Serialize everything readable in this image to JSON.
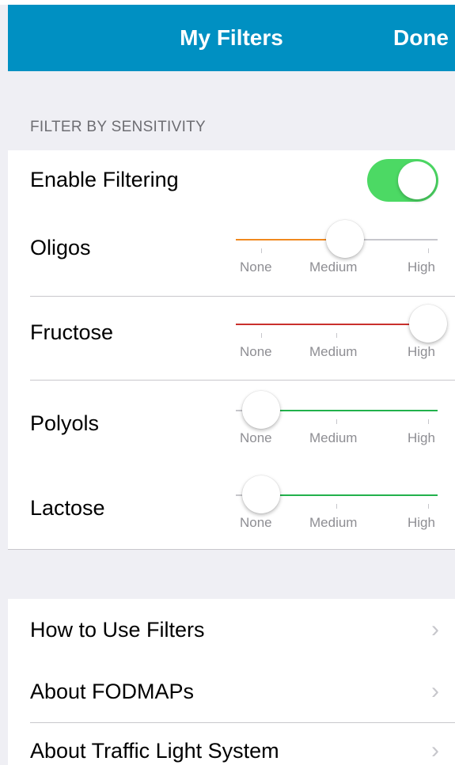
{
  "nav": {
    "title": "My Filters",
    "done_label": "Done"
  },
  "section_header": "FILTER BY SENSITIVITY",
  "enable_filtering": {
    "label": "Enable Filtering",
    "on": true,
    "color": "#4cd964"
  },
  "tick_labels": {
    "none": "None",
    "medium": "Medium",
    "high": "High"
  },
  "sliders": [
    {
      "label": "Oligos",
      "level": "Medium",
      "value": 0.5,
      "color": "#f0891f"
    },
    {
      "label": "Fructose",
      "level": "High",
      "value": 1.0,
      "color": "#c9302c"
    },
    {
      "label": "Polyols",
      "level": "None",
      "value": 0.0,
      "color": "#22b14c"
    },
    {
      "label": "Lactose",
      "level": "None",
      "value": 0.0,
      "color": "#22b14c"
    }
  ],
  "links": [
    {
      "label": "How to Use Filters"
    },
    {
      "label": "About FODMAPs"
    },
    {
      "label": "About Traffic Light System"
    }
  ]
}
